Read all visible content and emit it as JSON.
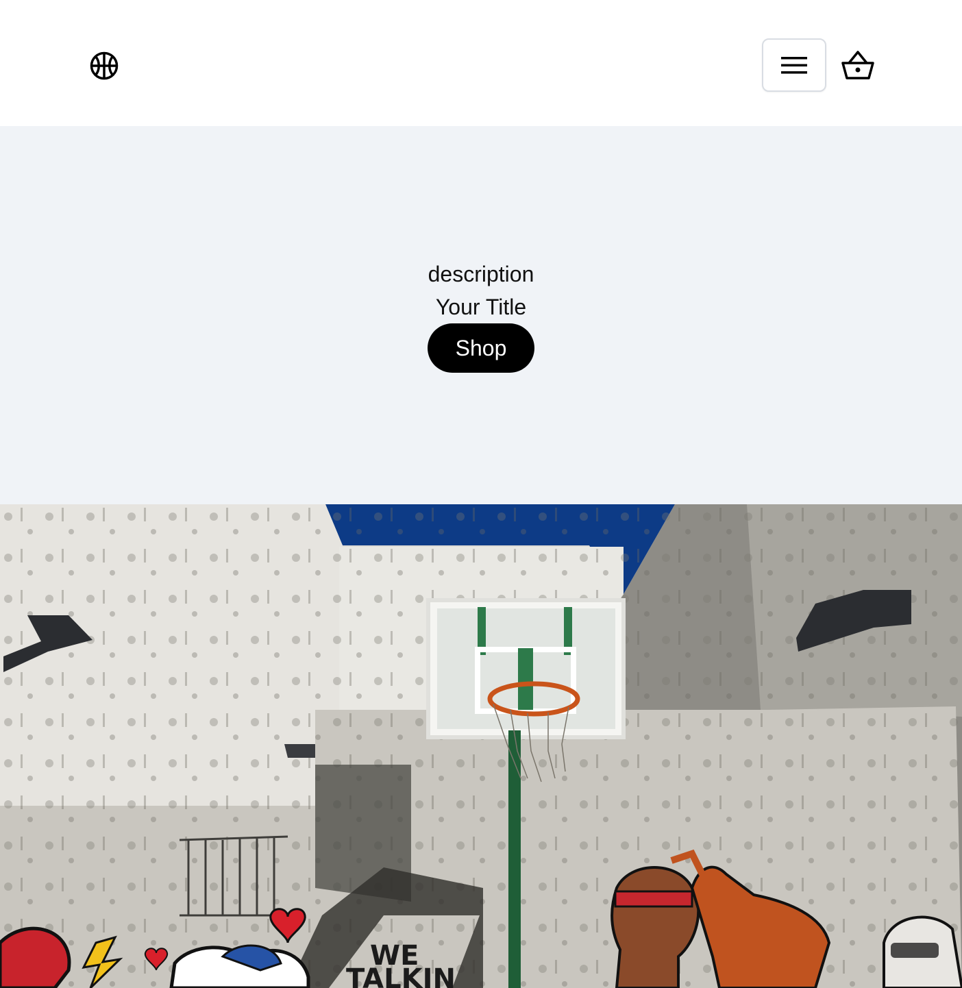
{
  "header": {
    "logo_icon": "basketball-icon",
    "menu_icon": "hamburger-menu-icon",
    "cart_icon": "shopping-basket-icon"
  },
  "hero": {
    "description": "description",
    "title": "Your Title",
    "cta_label": "Shop",
    "background_color": "#f0f3f7",
    "button_color": "#000000"
  },
  "photo": {
    "subject": "outdoor basketball hoop against graffiti concrete wall",
    "mural_text_line1": "WE",
    "mural_text_line2": "TALKIN",
    "sky_color": "#0d3b86"
  }
}
